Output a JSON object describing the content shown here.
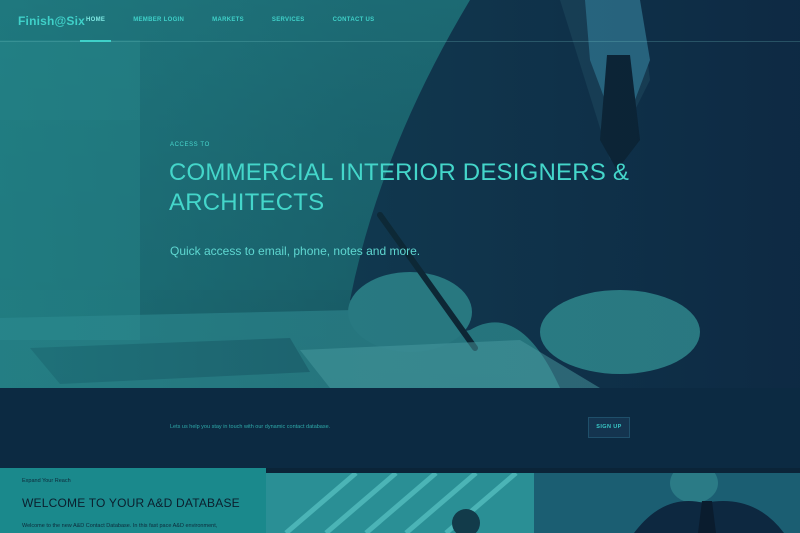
{
  "nav": {
    "logo": "Finish@Six",
    "links": [
      {
        "label": "HOME",
        "active": true
      },
      {
        "label": "MEMBER LOGIN",
        "active": false
      },
      {
        "label": "MARKETS",
        "active": false
      },
      {
        "label": "SERVICES",
        "active": false
      },
      {
        "label": "CONTACT US",
        "active": false
      }
    ]
  },
  "hero": {
    "kicker": "ACCESS TO",
    "title": "COMMERCIAL INTERIOR DESIGNERS & ARCHITECTS",
    "subtitle": "Quick access to email, phone, notes and more."
  },
  "band": {
    "text": "Lets us help you stay in touch with our dynamic contact database.",
    "signup_label": "SIGN UP"
  },
  "welcome": {
    "kicker": "Expand Your Reach",
    "title": "WELCOME TO YOUR A&D DATABASE",
    "body": "Welcome to the new A&D Contact Database. In this fast pace A&D environment,"
  },
  "colors": {
    "accent": "#3fd1c9",
    "hero_tint": "#1e6f77",
    "band_bg": "#0c2a42",
    "welcome_bg": "#1a898c"
  }
}
